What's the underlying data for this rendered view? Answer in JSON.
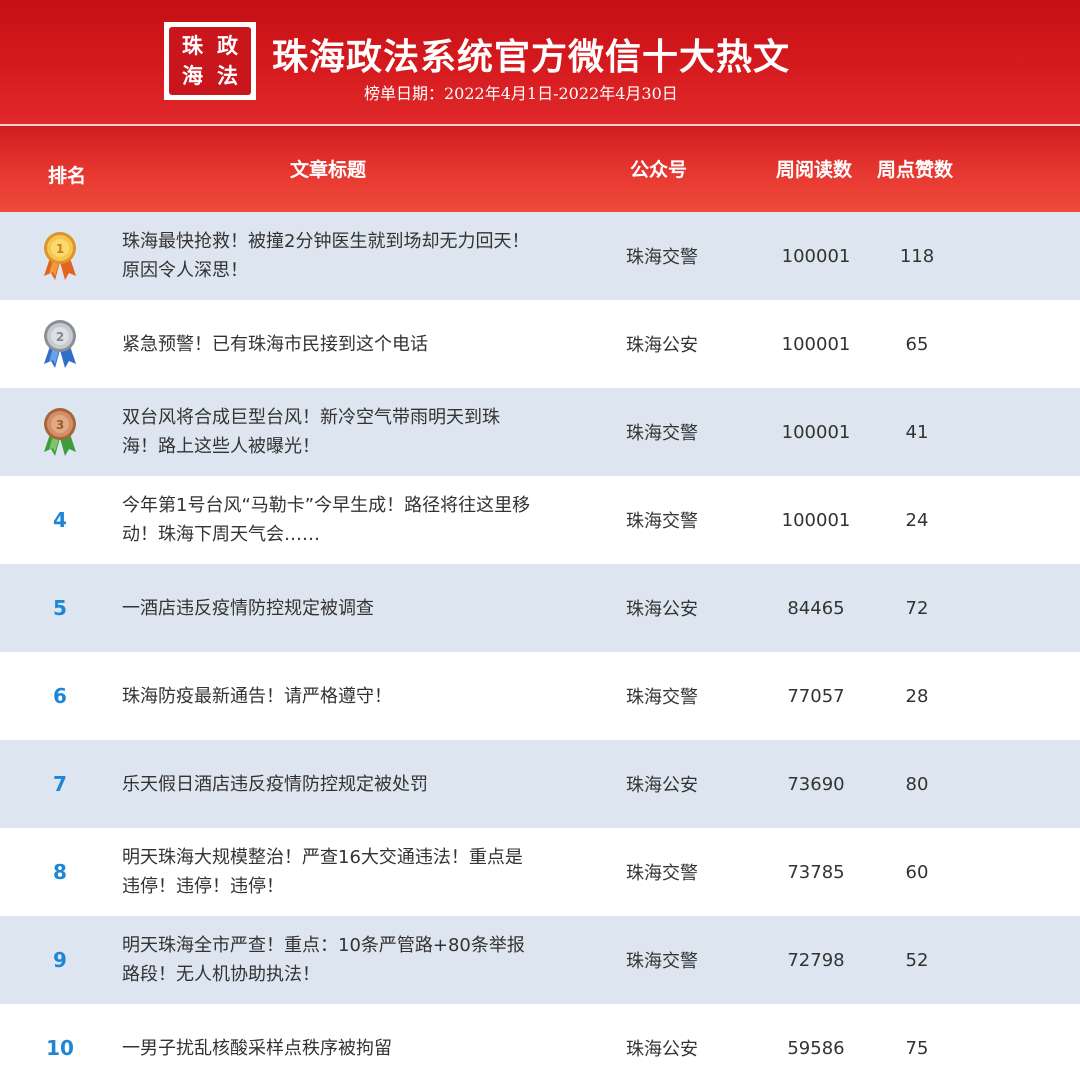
{
  "header": {
    "logo": {
      "line1": "珠海",
      "line2": "政法"
    },
    "title": "珠海政法系统官方微信十大热文",
    "subtitle": "榜单日期：2022年4月1日-2022年4月30日",
    "colors": {
      "primary_red": "#d61b1f",
      "row_shade": "#dde6f0",
      "rank_blue": "#1f86d6"
    }
  },
  "columns": {
    "rank": "排名",
    "title": "文章标题",
    "account": "公众号",
    "reads": "周阅读数",
    "likes": "周点赞数"
  },
  "rows": [
    {
      "rank": "",
      "medal": "gold-medal-icon",
      "title": "珠海最快抢救！被撞2分钟医生就到场却无力回天！原因令人深思！",
      "account": "珠海交警",
      "reads": "100001",
      "likes": "118"
    },
    {
      "rank": "",
      "medal": "silver-medal-icon",
      "title": "紧急预警！已有珠海市民接到这个电话",
      "account": "珠海公安",
      "reads": "100001",
      "likes": "65"
    },
    {
      "rank": "",
      "medal": "bronze-medal-icon",
      "title": "双台风将合成巨型台风！新冷空气带雨明天到珠海！路上这些人被曝光！",
      "account": "珠海交警",
      "reads": "100001",
      "likes": "41"
    },
    {
      "rank": "4",
      "title": "今年第1号台风“马勒卡”今早生成！路径将往这里移动！珠海下周天气会……",
      "account": "珠海交警",
      "reads": "100001",
      "likes": "24"
    },
    {
      "rank": "5",
      "title": "一酒店违反疫情防控规定被调查",
      "account": "珠海公安",
      "reads": "84465",
      "likes": "72"
    },
    {
      "rank": "6",
      "title": "珠海防疫最新通告！请严格遵守！",
      "account": "珠海交警",
      "reads": "77057",
      "likes": "28"
    },
    {
      "rank": "7",
      "title": "乐天假日酒店违反疫情防控规定被处罚",
      "account": "珠海公安",
      "reads": "73690",
      "likes": "80"
    },
    {
      "rank": "8",
      "title": "明天珠海大规模整治！严查16大交通违法！重点是违停！违停！违停！",
      "account": "珠海交警",
      "reads": "73785",
      "likes": "60"
    },
    {
      "rank": "9",
      "title": "明天珠海全市严查！重点：10条严管路+80条举报路段！无人机协助执法！",
      "account": "珠海交警",
      "reads": "72798",
      "likes": "52"
    },
    {
      "rank": "10",
      "title": "一男子扰乱核酸采样点秩序被拘留",
      "account": "珠海公安",
      "reads": "59586",
      "likes": "75"
    }
  ]
}
